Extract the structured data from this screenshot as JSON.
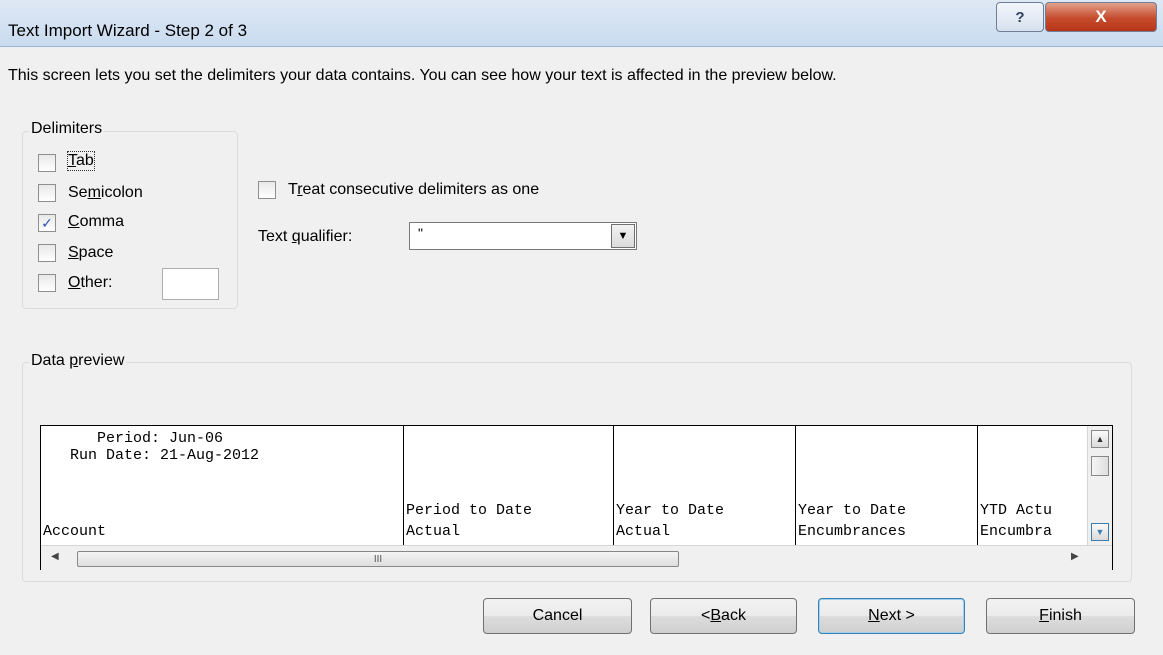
{
  "window": {
    "title": "Text Import Wizard - Step 2 of 3",
    "help_label": "?",
    "close_label": "X"
  },
  "description": "This screen lets you set the delimiters your data contains.  You can see how your text is affected in the preview below.",
  "delimiters": {
    "group_label": "Delimiters",
    "items": [
      {
        "label": "Tab",
        "checked": false
      },
      {
        "label": "Semicolon",
        "checked": false
      },
      {
        "label": "Comma",
        "checked": true
      },
      {
        "label": "Space",
        "checked": false
      },
      {
        "label": "Other:",
        "checked": false
      }
    ],
    "other_value": ""
  },
  "options": {
    "consecutive_label": "Treat consecutive delimiters as one",
    "consecutive_checked": false,
    "qualifier_label": "Text qualifier:",
    "qualifier_value": "\""
  },
  "preview": {
    "group_label": "Data preview",
    "columns": [
      {
        "lines": [
          "      Period: Jun-06",
          "   Run Date: 21-Aug-2012",
          "",
          "",
          "Account"
        ]
      },
      {
        "lines": [
          "",
          "",
          "",
          "Period to Date",
          "Actual"
        ]
      },
      {
        "lines": [
          "",
          "",
          "",
          "Year to Date",
          "Actual"
        ]
      },
      {
        "lines": [
          "",
          "",
          "",
          "Year to Date",
          "Encumbrances"
        ]
      },
      {
        "lines": [
          "",
          "",
          "",
          "YTD Actu",
          "Encumbra"
        ]
      }
    ],
    "hscroll_grip": "III"
  },
  "buttons": {
    "cancel": "Cancel",
    "back": "< Back",
    "next": "Next >",
    "finish": "Finish"
  }
}
